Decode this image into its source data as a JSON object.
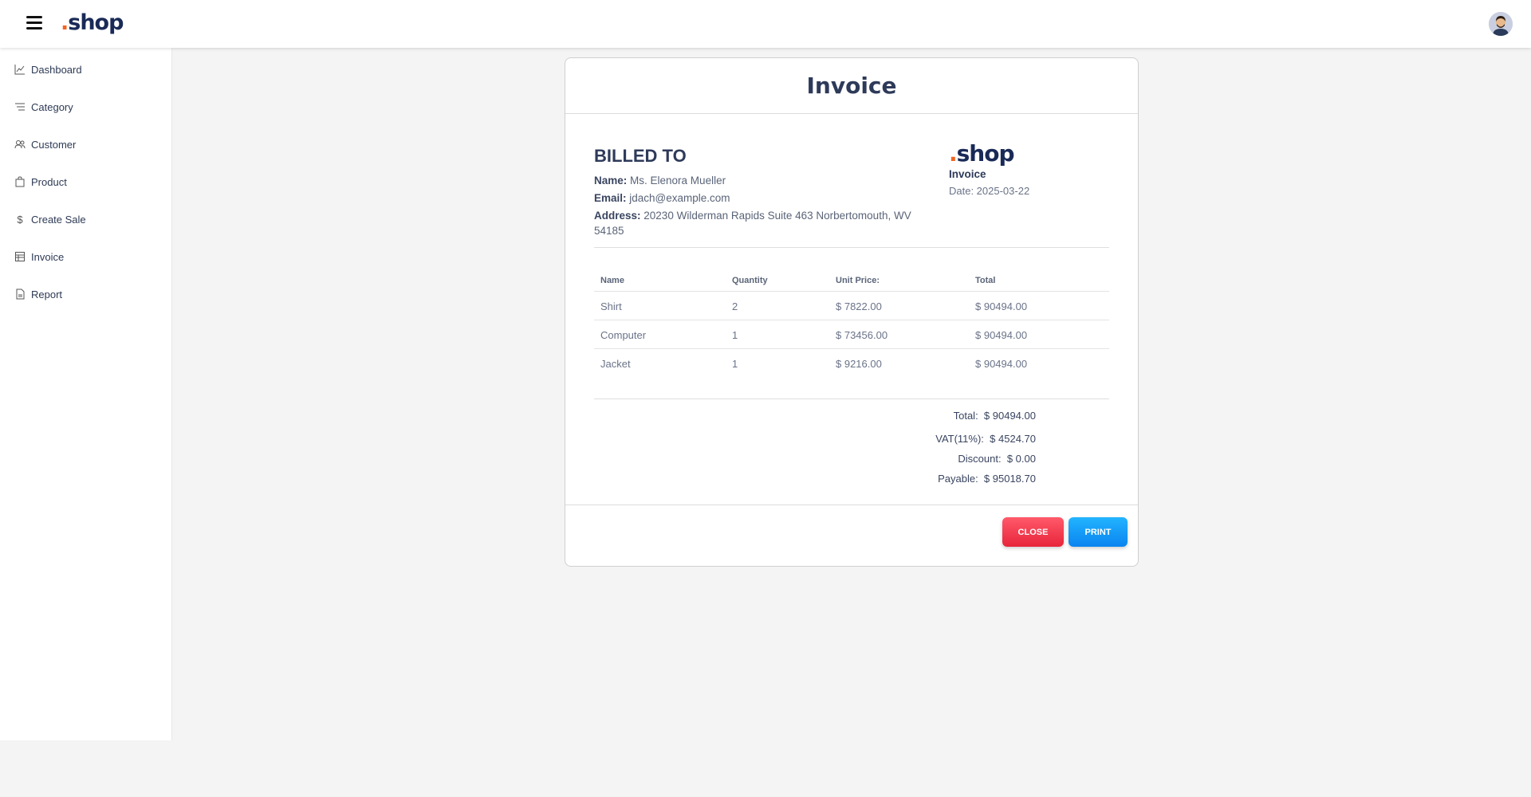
{
  "header": {
    "logo_dot": ".",
    "logo_text": "shop",
    "menu_icon": "hamburger-icon",
    "avatar_icon": "user-avatar"
  },
  "sidebar": {
    "items": [
      {
        "label": "Dashboard",
        "icon": "chart-line-icon"
      },
      {
        "label": "Category",
        "icon": "list-icon"
      },
      {
        "label": "Customer",
        "icon": "users-icon"
      },
      {
        "label": "Product",
        "icon": "bag-icon"
      },
      {
        "label": "Create Sale",
        "icon": "dollar-icon"
      },
      {
        "label": "Invoice",
        "icon": "table-icon"
      },
      {
        "label": "Report",
        "icon": "file-icon"
      }
    ]
  },
  "invoice": {
    "title": "Invoice",
    "billed_to_heading": "BILLED TO",
    "name_label": "Name:",
    "name_value": "Ms. Elenora Mueller",
    "email_label": "Email:",
    "email_value": "jdach@example.com",
    "address_label": "Address:",
    "address_value": "20230 Wilderman Rapids Suite 463 Norbertomouth, WV 54185",
    "brand_dot": ".",
    "brand_text": "shop",
    "brand_sub": "Invoice",
    "date": "Date: 2025-03-22",
    "columns": [
      "Name",
      "Quantity",
      "Unit Price:",
      "Total"
    ],
    "rows": [
      {
        "name": "Shirt",
        "qty": "2",
        "unit": "$ 7822.00",
        "total": "$ 90494.00"
      },
      {
        "name": "Computer",
        "qty": "1",
        "unit": "$ 73456.00",
        "total": "$ 90494.00"
      },
      {
        "name": "Jacket",
        "qty": "1",
        "unit": "$ 9216.00",
        "total": "$ 90494.00"
      }
    ],
    "totals": {
      "total_label": "Total:",
      "total_value": "$ 90494.00",
      "vat_label": "VAT(11%):",
      "vat_value": "$ 4524.70",
      "discount_label": "Discount:",
      "discount_value": "$ 0.00",
      "payable_label": "Payable:",
      "payable_value": "$ 95018.70"
    },
    "close_label": "CLOSE",
    "print_label": "PRINT"
  },
  "colors": {
    "brand": "#1a2a57",
    "brand_dot": "#f26522",
    "close": "#f0364a",
    "print": "#0f97f7"
  }
}
